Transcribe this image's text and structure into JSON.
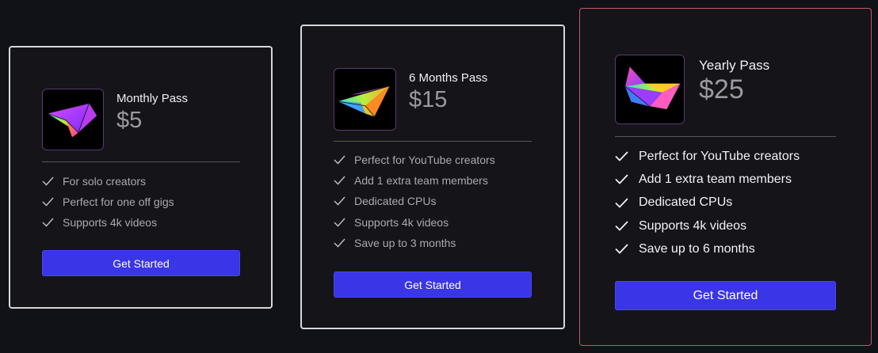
{
  "plans": [
    {
      "name": "Monthly Pass",
      "price": "$5",
      "features": [
        "For solo creators",
        "Perfect for one off gigs",
        "Supports 4k videos"
      ],
      "cta": "Get Started"
    },
    {
      "name": "6 Months Pass",
      "price": "$15",
      "features": [
        "Perfect for YouTube creators",
        "Add 1 extra team members",
        "Dedicated CPUs",
        "Supports 4k videos",
        "Save up to 3 months"
      ],
      "cta": "Get Started"
    },
    {
      "name": "Yearly Pass",
      "price": "$25",
      "features": [
        "Perfect for YouTube creators",
        "Add 1 extra team members",
        "Dedicated CPUs",
        "Supports 4k videos",
        "Save up to 6 months"
      ],
      "cta": "Get Started"
    }
  ],
  "icons": {
    "plan_logo": "paper-plane-logo",
    "feature_check": "check-icon"
  },
  "colors": {
    "background": "#111118",
    "card_background": "#141419",
    "card_border": "#d6d6dc",
    "highlight_border": "#c25a63",
    "button": "#3a35e6",
    "price_text": "#9a9aa2"
  }
}
